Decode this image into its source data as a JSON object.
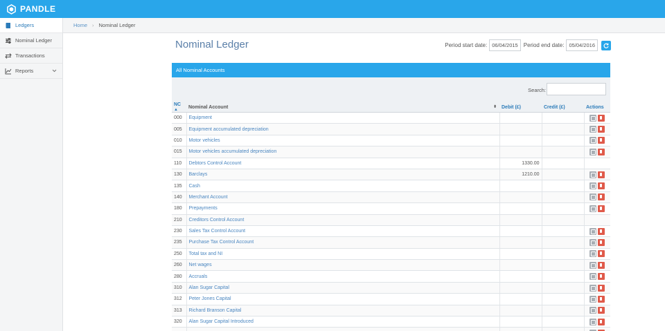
{
  "app": {
    "name": "PANDLE"
  },
  "sidebar": {
    "items": [
      {
        "label": "Ledgers",
        "icon": "book-icon",
        "active": true
      },
      {
        "label": "Nominal Ledger",
        "icon": "sliders-icon"
      },
      {
        "label": "Transactions",
        "icon": "arrows-icon"
      },
      {
        "label": "Reports",
        "icon": "chart-icon",
        "has_dropdown": true
      }
    ]
  },
  "breadcrumb": {
    "home": "Home",
    "separator": "›",
    "current": "Nominal Ledger"
  },
  "page": {
    "title": "Nominal Ledger"
  },
  "period": {
    "start_label": "Period start date:",
    "start_value": "06/04/2015",
    "end_label": "Period end date:",
    "end_value": "05/04/2016"
  },
  "panel": {
    "title": "All Nominal Accounts"
  },
  "search": {
    "label": "Search:",
    "value": ""
  },
  "table": {
    "columns": {
      "nc": "NC",
      "account": "Nominal Account",
      "debit": "Debit (£)",
      "credit": "Credit (£)",
      "actions": "Actions"
    },
    "rows": [
      {
        "nc": "000",
        "account": "Equipment",
        "debit": "",
        "credit": "",
        "actions": true
      },
      {
        "nc": "005",
        "account": "Equipment accumulated depreciation",
        "debit": "",
        "credit": "",
        "actions": true
      },
      {
        "nc": "010",
        "account": "Motor vehicles",
        "debit": "",
        "credit": "",
        "actions": true
      },
      {
        "nc": "015",
        "account": "Motor vehicles accumulated depreciation",
        "debit": "",
        "credit": "",
        "actions": true
      },
      {
        "nc": "110",
        "account": "Debtors Control Account",
        "debit": "1330.00",
        "credit": "",
        "actions": false
      },
      {
        "nc": "130",
        "account": "Barclays",
        "debit": "1210.00",
        "credit": "",
        "actions": true
      },
      {
        "nc": "135",
        "account": "Cash",
        "debit": "",
        "credit": "",
        "actions": true
      },
      {
        "nc": "140",
        "account": "Merchant Account",
        "debit": "",
        "credit": "",
        "actions": true
      },
      {
        "nc": "180",
        "account": "Prepayments",
        "debit": "",
        "credit": "",
        "actions": true
      },
      {
        "nc": "210",
        "account": "Creditors Control Account",
        "debit": "",
        "credit": "",
        "actions": false
      },
      {
        "nc": "230",
        "account": "Sales Tax Control Account",
        "debit": "",
        "credit": "",
        "actions": true
      },
      {
        "nc": "235",
        "account": "Purchase Tax Control Account",
        "debit": "",
        "credit": "",
        "actions": true
      },
      {
        "nc": "250",
        "account": "Total tax and NI",
        "debit": "",
        "credit": "",
        "actions": true
      },
      {
        "nc": "260",
        "account": "Net wages",
        "debit": "",
        "credit": "",
        "actions": true
      },
      {
        "nc": "280",
        "account": "Accruals",
        "debit": "",
        "credit": "",
        "actions": true
      },
      {
        "nc": "310",
        "account": "Alan Sugar Capital",
        "debit": "",
        "credit": "",
        "actions": true
      },
      {
        "nc": "312",
        "account": "Peter Jones Capital",
        "debit": "",
        "credit": "",
        "actions": true
      },
      {
        "nc": "313",
        "account": "Richard Branson Capital",
        "debit": "",
        "credit": "",
        "actions": true
      },
      {
        "nc": "320",
        "account": "Alan Sugar Capital Introduced",
        "debit": "",
        "credit": "",
        "actions": true
      },
      {
        "nc": "",
        "account": "",
        "debit": "",
        "credit": "",
        "actions": true
      }
    ]
  },
  "colors": {
    "brand": "#29a6ea",
    "link": "#4a86c0",
    "delete": "#e05a4a",
    "edit": "#a8aeb4"
  }
}
